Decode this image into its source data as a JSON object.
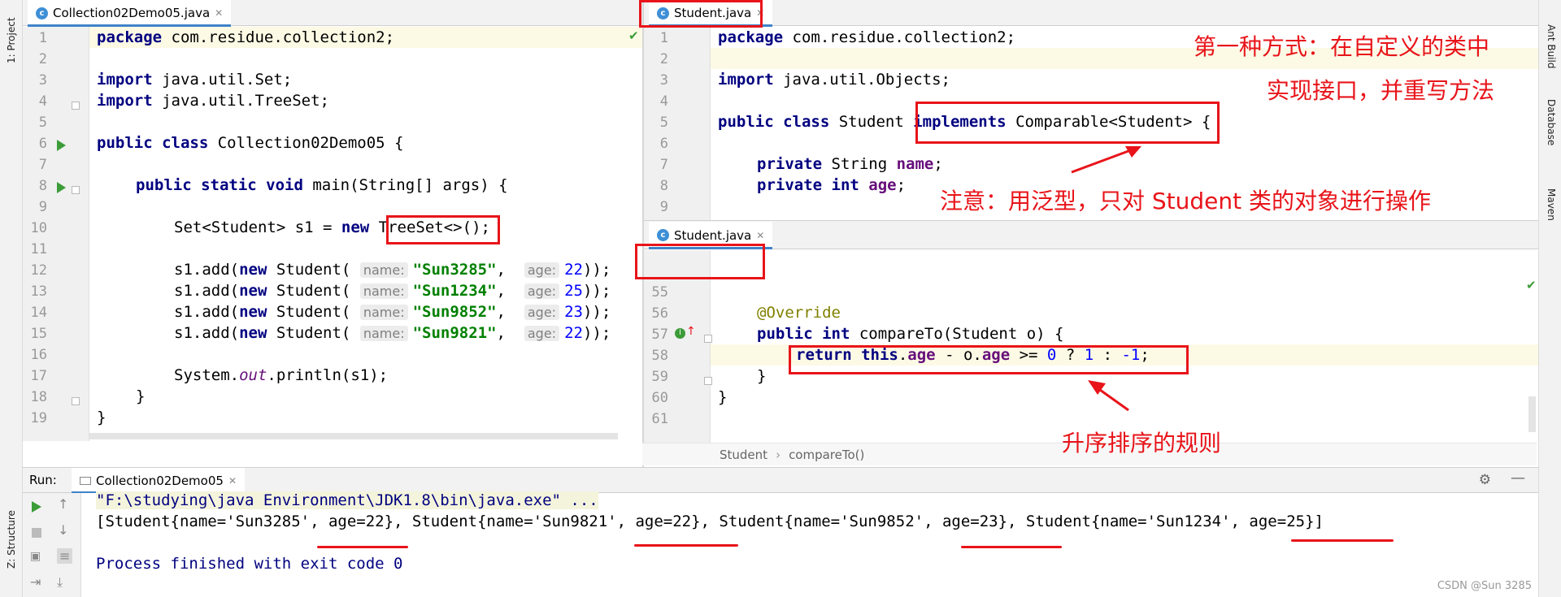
{
  "side_left": {
    "project_label": "1: Project",
    "structure_label": "Z: Structure"
  },
  "side_right": {
    "ant_label": "Ant Build",
    "db_label": "Database",
    "maven_label": "Maven"
  },
  "left_editor": {
    "tab": "Collection02Demo05.java",
    "lines": [
      "1",
      "2",
      "3",
      "4",
      "5",
      "6",
      "7",
      "8",
      "9",
      "10",
      "11",
      "12",
      "13",
      "14",
      "15",
      "16",
      "17",
      "18",
      "19"
    ],
    "code": {
      "l1_kw": "package",
      "l1_rest": " com.residue.collection2;",
      "l3_kw": "import",
      "l3_rest": " java.util.Set;",
      "l4_kw": "import",
      "l4_rest": " java.util.TreeSet;",
      "l6_kw": "public class",
      "l6_rest": " Collection02Demo05 {",
      "l8_kw": "public static void",
      "l8_rest": " main(String[] args) {",
      "l10_a": "Set<Student> s1 = ",
      "l10_kw": "new",
      "l10_b": " TreeSet<>();",
      "add_pre": "s1.add(",
      "add_new": "new",
      "add_cls": " Student(",
      "hint_name": "name:",
      "hint_age": "age:",
      "s12_name": "\"Sun3285\"",
      "s12_age": "22",
      "s13_name": "\"Sun1234\"",
      "s13_age": "25",
      "s14_name": "\"Sun9852\"",
      "s14_age": "23",
      "s15_name": "\"Sun9821\"",
      "s15_age": "22",
      "add_end": "));",
      "comma": ",",
      "l17_a": "System.",
      "l17_out": "out",
      "l17_b": ".println(s1);",
      "l18": "}",
      "l19": "}"
    }
  },
  "right_top_editor": {
    "tab": "Student.java",
    "lines": [
      "1",
      "2",
      "3",
      "4",
      "5",
      "6",
      "7",
      "8",
      "9"
    ],
    "code": {
      "l1_kw": "package",
      "l1_rest": " com.residue.collection2;",
      "l3_kw": "import",
      "l3_rest": " java.util.Objects;",
      "l5_kw": "public class",
      "l5_mid": " Student ",
      "l5_impl": "implements",
      "l5_rest": " Comparable<Student> {",
      "l7_kw": "private",
      "l7_type": " String ",
      "l7_f": "name",
      "l7_end": ";",
      "l8_kw": "private int",
      "l8_f": " age",
      "l8_end": ";"
    }
  },
  "right_bottom_editor": {
    "tab": "Student.java",
    "lines": [
      "55",
      "56",
      "57",
      "58",
      "59",
      "60",
      "61"
    ],
    "code": {
      "l56": "@Override",
      "l57_kw": "public int",
      "l57_rest": " compareTo(Student o) {",
      "l58_ret": "return",
      "l58_this": " this",
      "l58_dot": ".",
      "l58_age": "age",
      "l58_mid": " - o.",
      "l58_age2": "age",
      "l58_op": " >= ",
      "l58_z": "0",
      "l58_q": " ? ",
      "l58_one": "1",
      "l58_c": " : ",
      "l58_neg": "-1",
      "l58_end": ";",
      "l59": "}",
      "l60": "}"
    },
    "breadcrumb_class": "Student",
    "breadcrumb_method": "compareTo()"
  },
  "annotations": {
    "note1_line1": "第一种方式：在自定义的类中",
    "note1_line2": "实现接口，并重写方法",
    "note2": "注意：用泛型，只对 Student 类的对象进行操作",
    "note3": "升序排序的规则"
  },
  "run_panel": {
    "label": "Run:",
    "tab": "Collection02Demo05",
    "cmd": "\"F:\\studying\\java Environment\\JDK1.8\\bin\\java.exe\" ...",
    "output": "[Student{name='Sun3285', age=22}, Student{name='Sun9821', age=22}, Student{name='Sun9852', age=23}, Student{name='Sun1234', age=25}]",
    "exit": "Process finished with exit code 0"
  },
  "watermark": "CSDN @Sun 3285",
  "colors": {
    "annotation_red": "#e8141a",
    "tab_accent": "#4083c9",
    "keyword": "#000080",
    "string": "#008000",
    "field": "#660e7a"
  }
}
